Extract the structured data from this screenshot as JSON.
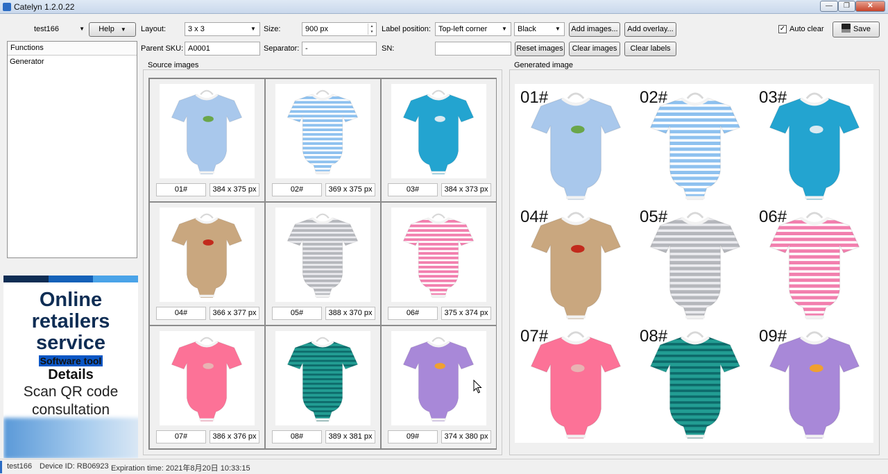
{
  "window": {
    "title": "Catelyn 1.2.0.22",
    "minimize_label": "—",
    "maximize_label": "❐",
    "close_label": "✕"
  },
  "toolbar": {
    "user": "test166",
    "help_label": "Help",
    "layout_label": "Layout:",
    "layout_value": "3 x 3",
    "size_label": "Size:",
    "size_value": "900 px",
    "label_position_label": "Label position:",
    "label_position_value": "Top-left corner",
    "color_value": "Black",
    "add_images_label": "Add images...",
    "add_overlay_label": "Add overlay...",
    "auto_clear_label": "Auto clear",
    "auto_clear_checked": true,
    "save_label": "Save",
    "parent_sku_label": "Parent SKU:",
    "parent_sku_value": "A0001",
    "separator_label": "Separator:",
    "separator_value": "-",
    "sn_label": "SN:",
    "sn_value": "",
    "reset_images_label": "Reset images",
    "clear_images_label": "Clear images",
    "clear_labels_label": "Clear labels"
  },
  "functions": {
    "header": "Functions",
    "items": [
      "Generator"
    ]
  },
  "ad": {
    "line1": "Online",
    "line2": "retailers",
    "line3": "service",
    "line4": "Software tool",
    "line5": "Details",
    "line6": "Scan QR code",
    "line7": "consultation",
    "colors": [
      "#0e2d54",
      "#1461b8",
      "#4aa3e8"
    ]
  },
  "source": {
    "title": "Source images",
    "images": [
      {
        "label": "01#",
        "dims": "384 x 375 px",
        "color": "#a9c8ec",
        "pattern": "solid",
        "motif": "#6aa64a"
      },
      {
        "label": "02#",
        "dims": "369 x 375 px",
        "color": "#8ec1ef",
        "pattern": "stripe",
        "stripe": "#ffffff",
        "motif": ""
      },
      {
        "label": "03#",
        "dims": "384 x 373 px",
        "color": "#23a4d0",
        "pattern": "solid",
        "motif": "#d9e9f1"
      },
      {
        "label": "04#",
        "dims": "366 x 377 px",
        "color": "#c9a77f",
        "pattern": "solid",
        "motif": "#c22a1c"
      },
      {
        "label": "05#",
        "dims": "388 x 370 px",
        "color": "#b5b7bc",
        "pattern": "stripe",
        "stripe": "#ececf0",
        "motif": ""
      },
      {
        "label": "06#",
        "dims": "375 x 374 px",
        "color": "#f27fae",
        "pattern": "stripe",
        "stripe": "#ffffff",
        "motif": ""
      },
      {
        "label": "07#",
        "dims": "386 x 376 px",
        "color": "#fc7297",
        "pattern": "solid",
        "motif": "#e8b3b3"
      },
      {
        "label": "08#",
        "dims": "389 x 381 px",
        "color": "#229d93",
        "pattern": "stripe",
        "stripe": "#0d6a6a",
        "motif": ""
      },
      {
        "label": "09#",
        "dims": "374 x 380 px",
        "color": "#a888d8",
        "pattern": "solid",
        "motif": "#f0a030"
      }
    ]
  },
  "generated": {
    "title": "Generated image"
  },
  "status": {
    "user": "test166",
    "device": "Device ID: RB06923",
    "expiration": "Expiration time: 2021年8月20日 10:33:15"
  }
}
